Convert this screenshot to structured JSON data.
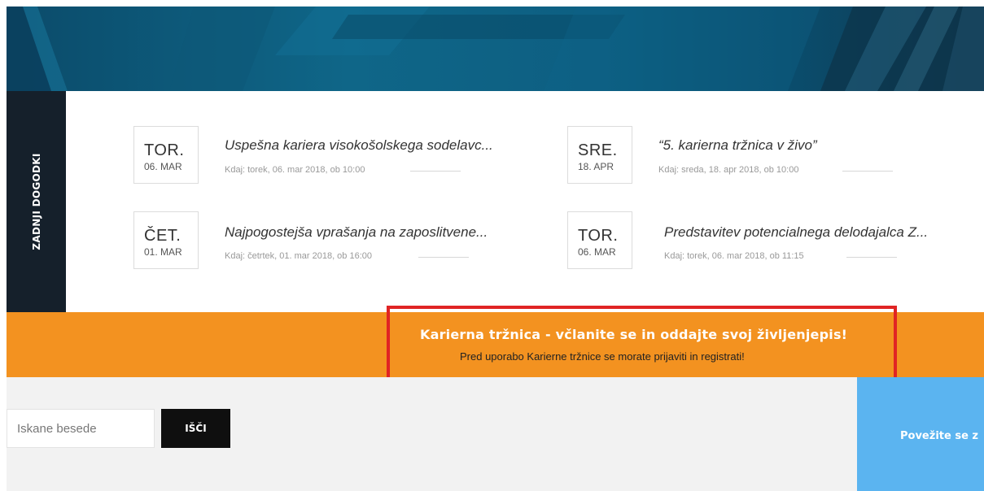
{
  "events_section": {
    "tab_label": "ZADNJI DOGODKI",
    "events": [
      {
        "day": "TOR.",
        "date": "06. MAR",
        "title": "Uspešna kariera visokošolskega sodelavc...",
        "when": "Kdaj: torek, 06. mar 2018, ob 10:00"
      },
      {
        "day": "SRE.",
        "date": "18. APR",
        "title": "“5. karierna tržnica v živo”",
        "when": "Kdaj: sreda, 18. apr 2018, ob 10:00"
      },
      {
        "day": "ČET.",
        "date": "01. MAR",
        "title": "Najpogostejša vprašanja na zaposlitvene...",
        "when": "Kdaj: četrtek, 01. mar 2018, ob 16:00"
      },
      {
        "day": "TOR.",
        "date": "06. MAR",
        "title": "Predstavitev potencialnega delodajalca Z...",
        "when": "Kdaj: torek, 06. mar 2018, ob 11:15"
      }
    ]
  },
  "banner": {
    "title": "Karierna tržnica - včlanite se in oddajte svoj življenjepis!",
    "subtitle": "Pred uporabo Karierne tržnice se morate prijaviti in registrati!"
  },
  "search": {
    "placeholder": "Iskane besede",
    "button_label": "IŠČI"
  },
  "cta": {
    "label": "Povežite se z"
  },
  "colors": {
    "banner_orange": "#f39220",
    "tab_dark": "#15202b",
    "cta_blue": "#5bb4f0",
    "highlight_red": "#e02424"
  }
}
